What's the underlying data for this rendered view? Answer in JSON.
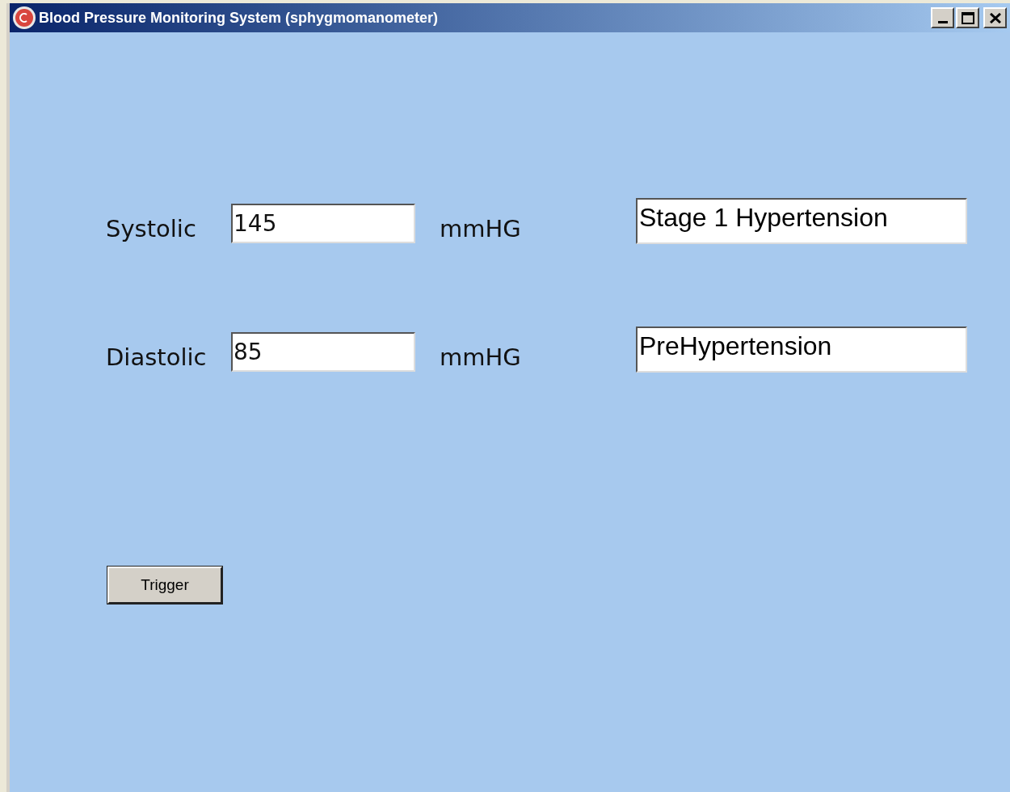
{
  "window": {
    "title": "Blood Pressure Monitoring System (sphygmomanometer)"
  },
  "readings": [
    {
      "label": "Systolic",
      "value": "145",
      "unit": "mmHG",
      "category": "Stage 1 Hypertension"
    },
    {
      "label": "Diastolic",
      "value": "85",
      "unit": "mmHG",
      "category": "PreHypertension"
    }
  ],
  "buttons": [
    "Trigger"
  ]
}
